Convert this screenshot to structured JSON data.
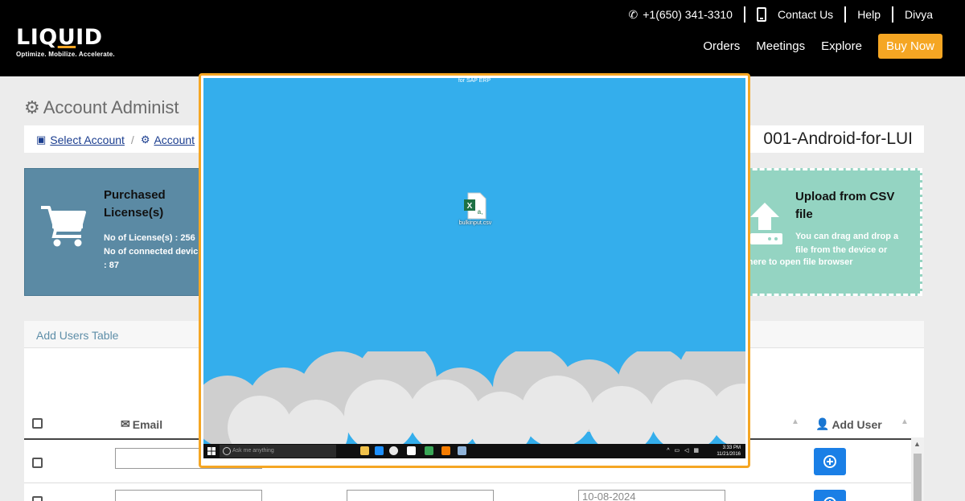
{
  "header": {
    "logo": {
      "word_pre": "LIQ",
      "word_u": "U",
      "word_post": "ID",
      "tagline": "Optimize. Mobilize. Accelerate."
    },
    "top": {
      "phone": "+1(650) 341-3310",
      "contact": "Contact Us",
      "help": "Help",
      "user": "Divya"
    },
    "nav": {
      "orders": "Orders",
      "meetings": "Meetings",
      "explore": "Explore",
      "buy": "Buy Now"
    }
  },
  "page": {
    "title": "Account Administ",
    "breadcrumb": {
      "select_account": "Select Account",
      "account": "Account",
      "separator": "/"
    },
    "account_name": "001-Android-for-LUI"
  },
  "license_card": {
    "title": "Purchased License(s)",
    "licenses": "No of License(s) : 256",
    "connected": "No of connected devic",
    "connected_value": ": 87"
  },
  "csv_card": {
    "title": "Upload from CSV file",
    "desc": "You can drag and drop a file from the device or",
    "desc2": "t here to open file browser"
  },
  "table": {
    "title": "Add Users Table",
    "col_email": "Email",
    "col_add_user": "Add User",
    "row2_date_value": "10-08-2024"
  },
  "desktop": {
    "window_title": "for SAP ERP",
    "file_name": "bulkinput.csv",
    "search_placeholder": "Ask me anything",
    "clock_time": "3:33 PM",
    "clock_date": "11/21/2016"
  },
  "colors": {
    "accent": "#f5a623",
    "license_card": "#5b8aa4",
    "csv_card": "#94d4c2",
    "desktop_bg": "#34aeec",
    "add_button": "#1a7fe6"
  }
}
